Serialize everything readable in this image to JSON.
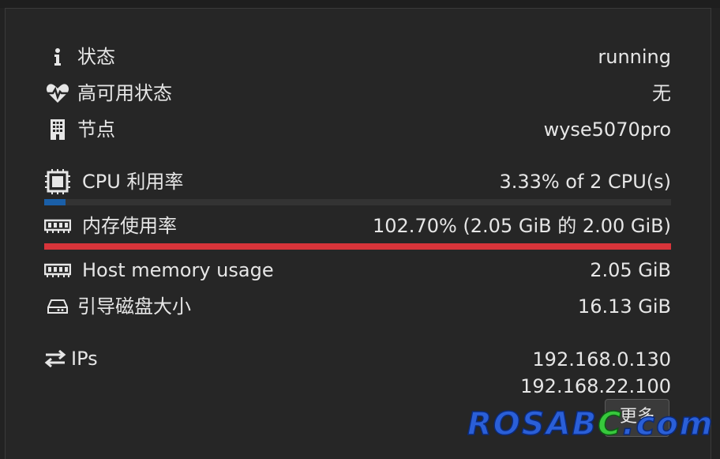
{
  "status": {
    "label": "状态",
    "value": "running",
    "icon": "info-icon"
  },
  "ha": {
    "label": "高可用状态",
    "value": "无",
    "icon": "heartbeat-icon"
  },
  "node": {
    "label": "节点",
    "value": "wyse5070pro",
    "icon": "building-icon"
  },
  "cpu": {
    "label": "CPU 利用率",
    "value": "3.33% of 2 CPU(s)",
    "icon": "cpu-icon",
    "usage_fraction": 0.0333,
    "bar_color": "#1a5fa8"
  },
  "memory": {
    "label": "内存使用率",
    "value": "102.70% (2.05 GiB 的 2.00 GiB)",
    "icon": "memory-icon",
    "usage_fraction": 1.0,
    "bar_color": "#d8343a"
  },
  "host_memory": {
    "label": "Host memory usage",
    "value": "2.05 GiB",
    "icon": "memory-icon"
  },
  "bootdisk": {
    "label": "引导磁盘大小",
    "value": "16.13 GiB",
    "icon": "hdd-icon"
  },
  "ips": {
    "label": "IPs",
    "values": [
      "192.168.0.130",
      "192.168.22.100"
    ],
    "icon": "exchange-icon"
  },
  "more_button": {
    "label": "更多"
  },
  "watermark": {
    "part1": "ROSAB",
    "part2": "C",
    "part3": ".com"
  }
}
